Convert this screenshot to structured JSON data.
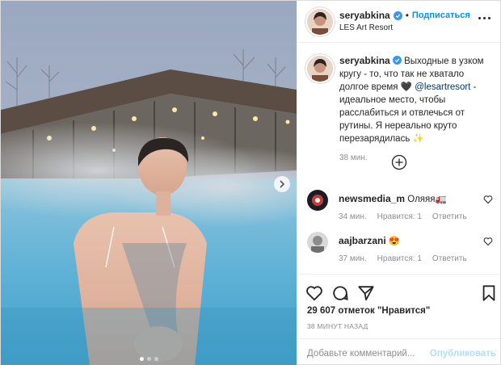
{
  "header": {
    "username": "seryabkina",
    "separator": "•",
    "follow_label": "Подписаться",
    "location": "LES Art Resort"
  },
  "caption": {
    "username": "seryabkina",
    "text_before_mention": "Выходные в узком кругу - то, что так не хватало долгое время 🖤 ",
    "mention": "@lesartresort",
    "text_after_mention": " - идеальное место, чтобы расслабиться и отвлечься от рутины. Я нереально круто перезарядилась ✨",
    "time": "38 мин."
  },
  "comments": [
    {
      "username": "newsmedia_m",
      "text": "Оляяя🚛",
      "time": "34 мин.",
      "likes": "Нравится: 1",
      "reply": "Ответить"
    },
    {
      "username": "aajbarzani",
      "text": "😍",
      "time": "37 мин.",
      "likes": "Нравится: 1",
      "reply": "Ответить"
    }
  ],
  "stats": {
    "likes_text": "29 607 отметок \"Нравится\"",
    "posted_ago": "38 МИНУТ НАЗАД"
  },
  "add_comment": {
    "placeholder": "Добавьте комментарий...",
    "publish_label": "Опубликовать"
  },
  "carousel": {
    "slide_count": 3,
    "active_index": 0
  },
  "colors": {
    "accent": "#0095f6",
    "mention": "#00376b",
    "muted": "#8e8e8e",
    "publish_disabled": "#b2dffc",
    "verified": "#3897f0"
  },
  "icons": [
    "verified-badge-icon",
    "more-options-icon",
    "add-comment-plus-icon",
    "heart-icon",
    "comment-icon",
    "share-icon",
    "bookmark-icon",
    "carousel-next-icon"
  ]
}
